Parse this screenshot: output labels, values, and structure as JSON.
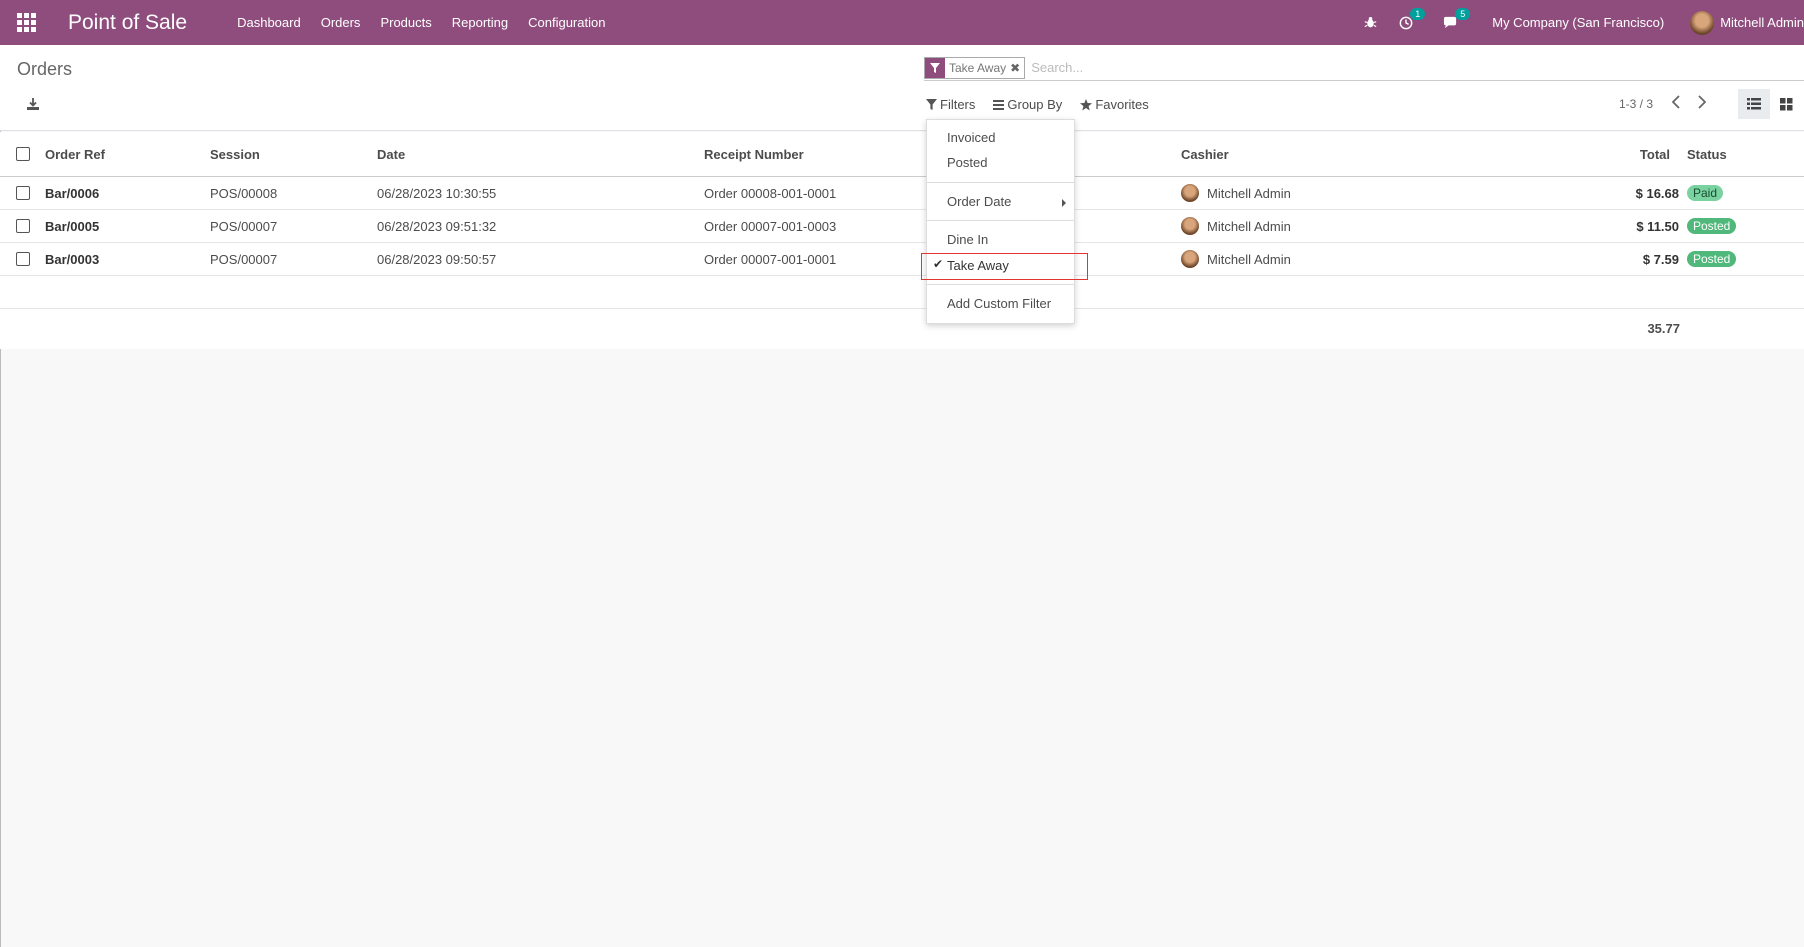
{
  "navbar": {
    "brand": "Point of Sale",
    "menu": [
      "Dashboard",
      "Orders",
      "Products",
      "Reporting",
      "Configuration"
    ],
    "activity_badge": "1",
    "messages_badge": "5",
    "company": "My Company (San Francisco)",
    "user": "Mitchell Admin",
    "accent_color": "#8f4d7e"
  },
  "control": {
    "breadcrumb": "Orders",
    "facet_value": "Take Away",
    "search_placeholder": "Search...",
    "filters_label": "Filters",
    "groupby_label": "Group By",
    "favorites_label": "Favorites",
    "pager": "1-3 / 3"
  },
  "table": {
    "columns": {
      "order_ref": "Order Ref",
      "session": "Session",
      "date": "Date",
      "receipt": "Receipt Number",
      "cashier": "Cashier",
      "total": "Total",
      "status": "Status"
    },
    "rows": [
      {
        "order_ref": "Bar/0006",
        "session": "POS/00008",
        "date": "06/28/2023 10:30:55",
        "receipt": "Order 00008-001-0001",
        "cashier": "Mitchell Admin",
        "total": "$ 16.68",
        "status": "Paid"
      },
      {
        "order_ref": "Bar/0005",
        "session": "POS/00007",
        "date": "06/28/2023 09:51:32",
        "receipt": "Order 00007-001-0003",
        "cashier": "Mitchell Admin",
        "total": "$ 11.50",
        "status": "Posted"
      },
      {
        "order_ref": "Bar/0003",
        "session": "POS/00007",
        "date": "06/28/2023 09:50:57",
        "receipt": "Order 00007-001-0001",
        "cashier": "Mitchell Admin",
        "total": "$ 7.59",
        "status": "Posted"
      }
    ],
    "sum_total": "35.77"
  },
  "filter_dropdown": {
    "invoiced": "Invoiced",
    "posted": "Posted",
    "order_date": "Order Date",
    "dine_in": "Dine In",
    "take_away": "Take Away",
    "add_custom": "Add Custom Filter"
  }
}
